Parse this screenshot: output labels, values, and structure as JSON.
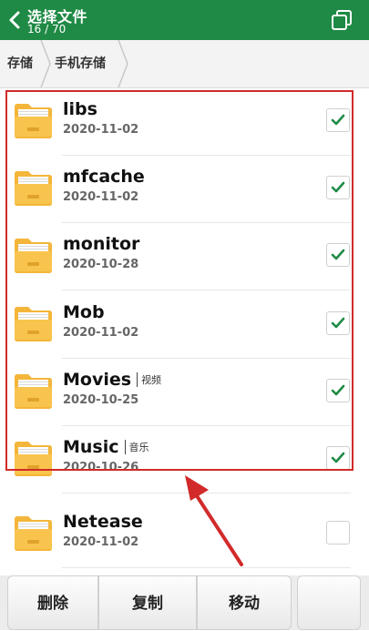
{
  "header": {
    "title": "选择文件",
    "count": "16 / 70",
    "bg": "#1f8a45"
  },
  "breadcrumb": {
    "storage": "存储",
    "phone_storage": "手机存储"
  },
  "files": [
    {
      "name": "libs",
      "date": "2020-11-02",
      "checked": true
    },
    {
      "name": "mfcache",
      "date": "2020-11-02",
      "checked": true
    },
    {
      "name": "monitor",
      "date": "2020-10-28",
      "checked": true
    },
    {
      "name": "Mob",
      "date": "2020-11-02",
      "checked": true
    },
    {
      "name": "Movies",
      "tag": "视频",
      "date": "2020-10-25",
      "checked": true
    },
    {
      "name": "Music",
      "tag": "音乐",
      "date": "2020-10-26",
      "checked": true
    },
    {
      "name": "Netease",
      "date": "2020-11-02",
      "checked": false
    }
  ],
  "toolbar": {
    "delete_label": "删除",
    "copy_label": "复制",
    "move_label": "移动"
  },
  "colors": {
    "check": "#1f8a45",
    "highlight": "#d22a2a",
    "folder": "#f4b63a"
  }
}
